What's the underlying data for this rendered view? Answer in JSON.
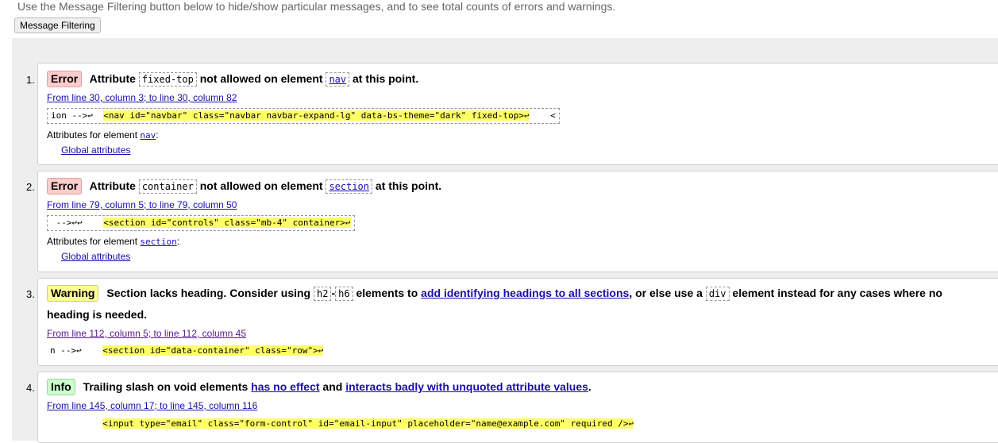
{
  "intro": "Use the Message Filtering button below to hide/show particular messages, and to see total counts of errors and warnings.",
  "filter_button": "Message Filtering",
  "messages": [
    {
      "num": "1.",
      "type": "Error",
      "t1": "Attribute",
      "c1": "fixed-top",
      "t2": "not allowed on element",
      "c2": "nav",
      "t3": "at this point.",
      "loc": "From line 30, column 3; to line 30, column 82",
      "ext_pre": "ion -->↩  ",
      "ext_hl": "<nav id=\"navbar\" class=\"navbar navbar-expand-lg\" data-bs-theme=\"dark\" fixed-top>↩",
      "ext_post": "    <",
      "attrs_label": "Attributes for element",
      "attrs_el": "nav",
      "attrs_colon": ":",
      "global": "Global attributes"
    },
    {
      "num": "2.",
      "type": "Error",
      "t1": "Attribute",
      "c1": "container",
      "t2": "not allowed on element",
      "c2": "section",
      "t3": "at this point.",
      "loc": "From line 79, column 5; to line 79, column 50",
      "ext_pre": " -->↩↩    ",
      "ext_hl": "<section id=\"controls\" class=\"mb-4\" container>↩",
      "ext_post": "",
      "attrs_label": "Attributes for element",
      "attrs_el": "section",
      "attrs_colon": ":",
      "global": "Global attributes"
    },
    {
      "num": "3.",
      "type": "Warning",
      "t1": "Section lacks heading. Consider using",
      "c1": "h2",
      "dash": "-",
      "c2": "h6",
      "t2": "elements to",
      "link1": "add identifying headings to all sections",
      "t3": ", or else use a",
      "c3": "div",
      "t4": "element instead for any cases where no",
      "t5": "heading is needed.",
      "loc": "From line 112, column 5; to line 112, column 45",
      "ext_pre": "n -->↩    ",
      "ext_hl": "<section id=\"data-container\" class=\"row\">↩",
      "ext_post": ""
    },
    {
      "num": "4.",
      "type": "Info",
      "t1": "Trailing slash on void elements",
      "link1": "has no effect",
      "t2": "and",
      "link2": "interacts badly with unquoted attribute values",
      "t3": ".",
      "loc": "From line 145, column 17; to line 145, column 116",
      "ext_pre": "          ",
      "ext_hl": "<input type=\"email\" class=\"form-control\" id=\"email-input\" placeholder=\"name@example.com\" required />↩",
      "ext_post": ""
    }
  ]
}
